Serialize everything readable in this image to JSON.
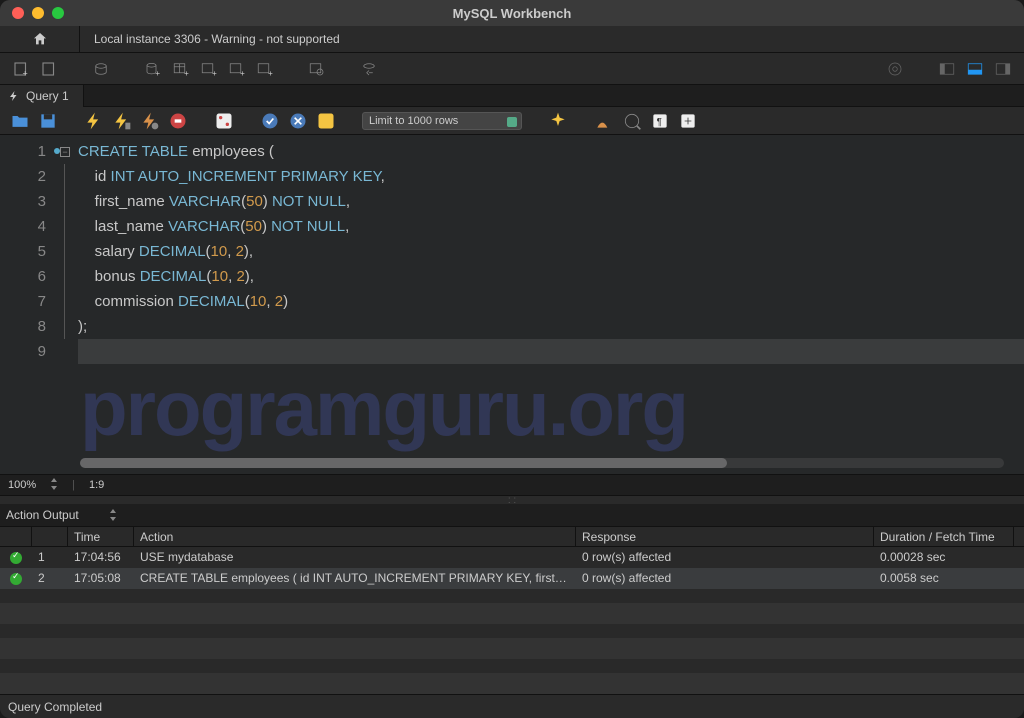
{
  "window": {
    "title": "MySQL Workbench"
  },
  "connection_tab": {
    "label": "Local instance 3306 - Warning - not supported"
  },
  "query_tab": {
    "label": "Query 1"
  },
  "editor_toolbar": {
    "limit_label": "Limit to 1000 rows"
  },
  "code": {
    "lines": [
      [
        [
          "kw",
          "CREATE"
        ],
        [
          "pn",
          " "
        ],
        [
          "kw",
          "TABLE"
        ],
        [
          "pn",
          " "
        ],
        [
          "id",
          "employees"
        ],
        [
          "pn",
          " ("
        ]
      ],
      [
        [
          "pn",
          "    "
        ],
        [
          "id",
          "id"
        ],
        [
          "pn",
          " "
        ],
        [
          "ty",
          "INT"
        ],
        [
          "pn",
          " "
        ],
        [
          "kw",
          "AUTO_INCREMENT"
        ],
        [
          "pn",
          " "
        ],
        [
          "kw",
          "PRIMARY"
        ],
        [
          "pn",
          " "
        ],
        [
          "kw",
          "KEY"
        ],
        [
          "pn",
          ","
        ]
      ],
      [
        [
          "pn",
          "    "
        ],
        [
          "id",
          "first_name"
        ],
        [
          "pn",
          " "
        ],
        [
          "ty",
          "VARCHAR"
        ],
        [
          "pn",
          "("
        ],
        [
          "num",
          "50"
        ],
        [
          "pn",
          ") "
        ],
        [
          "kw",
          "NOT"
        ],
        [
          "pn",
          " "
        ],
        [
          "kw",
          "NULL"
        ],
        [
          "pn",
          ","
        ]
      ],
      [
        [
          "pn",
          "    "
        ],
        [
          "id",
          "last_name"
        ],
        [
          "pn",
          " "
        ],
        [
          "ty",
          "VARCHAR"
        ],
        [
          "pn",
          "("
        ],
        [
          "num",
          "50"
        ],
        [
          "pn",
          ") "
        ],
        [
          "kw",
          "NOT"
        ],
        [
          "pn",
          " "
        ],
        [
          "kw",
          "NULL"
        ],
        [
          "pn",
          ","
        ]
      ],
      [
        [
          "pn",
          "    "
        ],
        [
          "id",
          "salary"
        ],
        [
          "pn",
          " "
        ],
        [
          "ty",
          "DECIMAL"
        ],
        [
          "pn",
          "("
        ],
        [
          "num",
          "10"
        ],
        [
          "pn",
          ", "
        ],
        [
          "num",
          "2"
        ],
        [
          "pn",
          "),"
        ]
      ],
      [
        [
          "pn",
          "    "
        ],
        [
          "id",
          "bonus"
        ],
        [
          "pn",
          " "
        ],
        [
          "ty",
          "DECIMAL"
        ],
        [
          "pn",
          "("
        ],
        [
          "num",
          "10"
        ],
        [
          "pn",
          ", "
        ],
        [
          "num",
          "2"
        ],
        [
          "pn",
          "),"
        ]
      ],
      [
        [
          "pn",
          "    "
        ],
        [
          "id",
          "commission"
        ],
        [
          "pn",
          " "
        ],
        [
          "ty",
          "DECIMAL"
        ],
        [
          "pn",
          "("
        ],
        [
          "num",
          "10"
        ],
        [
          "pn",
          ", "
        ],
        [
          "num",
          "2"
        ],
        [
          "pn",
          ")"
        ]
      ],
      [
        [
          "pn",
          ");"
        ]
      ],
      [
        [
          "pn",
          ""
        ]
      ]
    ],
    "line_count": 9,
    "current_line": 9
  },
  "status": {
    "zoom": "100%",
    "pos": "1:9"
  },
  "output": {
    "label": "Action Output",
    "headers": {
      "time": "Time",
      "action": "Action",
      "response": "Response",
      "duration": "Duration / Fetch Time"
    },
    "rows": [
      {
        "idx": "1",
        "time": "17:04:56",
        "action": "USE mydatabase",
        "response": "0 row(s) affected",
        "duration": "0.00028 sec"
      },
      {
        "idx": "2",
        "time": "17:05:08",
        "action": "CREATE TABLE employees (     id INT AUTO_INCREMENT PRIMARY KEY,     first_n…",
        "response": "0 row(s) affected",
        "duration": "0.0058 sec"
      }
    ]
  },
  "footer": {
    "status": "Query Completed"
  },
  "watermark": "programguru.org"
}
